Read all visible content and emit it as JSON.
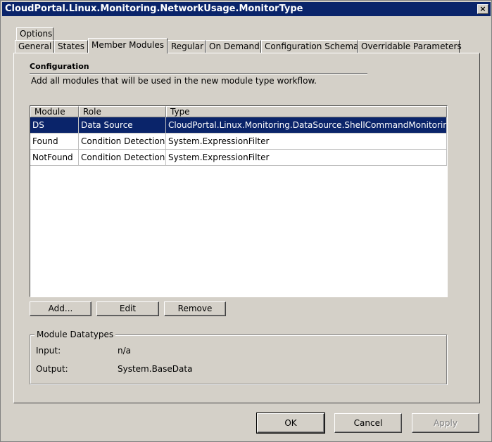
{
  "window": {
    "title": "CloudPortal.Linux.Monitoring.NetworkUsage.MonitorType",
    "close_glyph": "×"
  },
  "tabs": {
    "row1": [
      {
        "label": "Options"
      }
    ],
    "row2": [
      {
        "label": "General"
      },
      {
        "label": "States"
      },
      {
        "label": "Member Modules",
        "active": true
      },
      {
        "label": "Regular"
      },
      {
        "label": "On Demand"
      },
      {
        "label": "Configuration Schema"
      },
      {
        "label": "Overridable Parameters"
      }
    ]
  },
  "configuration": {
    "title": "Configuration",
    "description": "Add all modules that will be used in the new module type workflow."
  },
  "modules_table": {
    "columns": [
      "Module",
      "Role",
      "Type"
    ],
    "rows": [
      {
        "module": "DS",
        "role": "Data Source",
        "type": "CloudPortal.Linux.Monitoring.DataSource.ShellCommandMonitoring",
        "selected": true
      },
      {
        "module": "Found",
        "role": "Condition Detection",
        "type": "System.ExpressionFilter",
        "selected": false
      },
      {
        "module": "NotFound",
        "role": "Condition Detection",
        "type": "System.ExpressionFilter",
        "selected": false
      }
    ]
  },
  "module_buttons": {
    "add": "Add...",
    "edit": "Edit",
    "remove": "Remove"
  },
  "datatypes": {
    "title": "Module Datatypes",
    "input_label": "Input:",
    "input_value": "n/a",
    "output_label": "Output:",
    "output_value": "System.BaseData"
  },
  "dialog_buttons": {
    "ok": "OK",
    "cancel": "Cancel",
    "apply": "Apply"
  },
  "colors": {
    "titlebar": "#0a246a",
    "selection": "#0a246a",
    "face": "#d4d0c8"
  }
}
